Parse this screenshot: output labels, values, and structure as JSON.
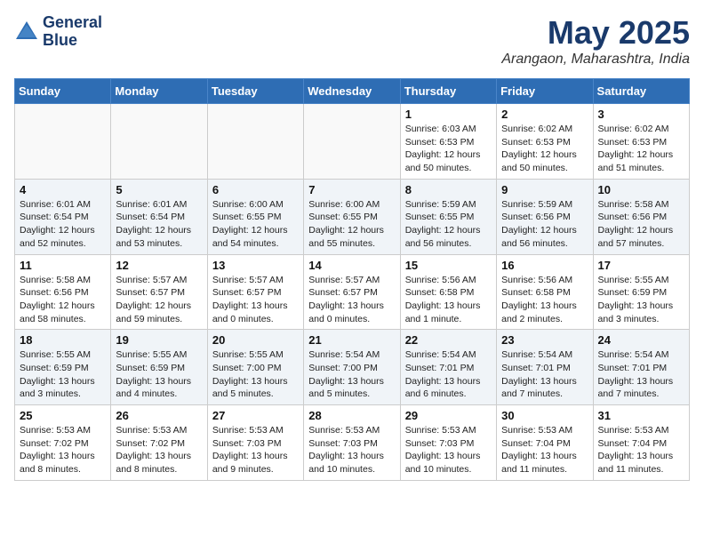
{
  "header": {
    "logo_line1": "General",
    "logo_line2": "Blue",
    "month": "May 2025",
    "location": "Arangaon, Maharashtra, India"
  },
  "weekdays": [
    "Sunday",
    "Monday",
    "Tuesday",
    "Wednesday",
    "Thursday",
    "Friday",
    "Saturday"
  ],
  "weeks": [
    [
      {
        "day": "",
        "info": ""
      },
      {
        "day": "",
        "info": ""
      },
      {
        "day": "",
        "info": ""
      },
      {
        "day": "",
        "info": ""
      },
      {
        "day": "1",
        "info": "Sunrise: 6:03 AM\nSunset: 6:53 PM\nDaylight: 12 hours and 50 minutes."
      },
      {
        "day": "2",
        "info": "Sunrise: 6:02 AM\nSunset: 6:53 PM\nDaylight: 12 hours and 50 minutes."
      },
      {
        "day": "3",
        "info": "Sunrise: 6:02 AM\nSunset: 6:53 PM\nDaylight: 12 hours and 51 minutes."
      }
    ],
    [
      {
        "day": "4",
        "info": "Sunrise: 6:01 AM\nSunset: 6:54 PM\nDaylight: 12 hours and 52 minutes."
      },
      {
        "day": "5",
        "info": "Sunrise: 6:01 AM\nSunset: 6:54 PM\nDaylight: 12 hours and 53 minutes."
      },
      {
        "day": "6",
        "info": "Sunrise: 6:00 AM\nSunset: 6:55 PM\nDaylight: 12 hours and 54 minutes."
      },
      {
        "day": "7",
        "info": "Sunrise: 6:00 AM\nSunset: 6:55 PM\nDaylight: 12 hours and 55 minutes."
      },
      {
        "day": "8",
        "info": "Sunrise: 5:59 AM\nSunset: 6:55 PM\nDaylight: 12 hours and 56 minutes."
      },
      {
        "day": "9",
        "info": "Sunrise: 5:59 AM\nSunset: 6:56 PM\nDaylight: 12 hours and 56 minutes."
      },
      {
        "day": "10",
        "info": "Sunrise: 5:58 AM\nSunset: 6:56 PM\nDaylight: 12 hours and 57 minutes."
      }
    ],
    [
      {
        "day": "11",
        "info": "Sunrise: 5:58 AM\nSunset: 6:56 PM\nDaylight: 12 hours and 58 minutes."
      },
      {
        "day": "12",
        "info": "Sunrise: 5:57 AM\nSunset: 6:57 PM\nDaylight: 12 hours and 59 minutes."
      },
      {
        "day": "13",
        "info": "Sunrise: 5:57 AM\nSunset: 6:57 PM\nDaylight: 13 hours and 0 minutes."
      },
      {
        "day": "14",
        "info": "Sunrise: 5:57 AM\nSunset: 6:57 PM\nDaylight: 13 hours and 0 minutes."
      },
      {
        "day": "15",
        "info": "Sunrise: 5:56 AM\nSunset: 6:58 PM\nDaylight: 13 hours and 1 minute."
      },
      {
        "day": "16",
        "info": "Sunrise: 5:56 AM\nSunset: 6:58 PM\nDaylight: 13 hours and 2 minutes."
      },
      {
        "day": "17",
        "info": "Sunrise: 5:55 AM\nSunset: 6:59 PM\nDaylight: 13 hours and 3 minutes."
      }
    ],
    [
      {
        "day": "18",
        "info": "Sunrise: 5:55 AM\nSunset: 6:59 PM\nDaylight: 13 hours and 3 minutes."
      },
      {
        "day": "19",
        "info": "Sunrise: 5:55 AM\nSunset: 6:59 PM\nDaylight: 13 hours and 4 minutes."
      },
      {
        "day": "20",
        "info": "Sunrise: 5:55 AM\nSunset: 7:00 PM\nDaylight: 13 hours and 5 minutes."
      },
      {
        "day": "21",
        "info": "Sunrise: 5:54 AM\nSunset: 7:00 PM\nDaylight: 13 hours and 5 minutes."
      },
      {
        "day": "22",
        "info": "Sunrise: 5:54 AM\nSunset: 7:01 PM\nDaylight: 13 hours and 6 minutes."
      },
      {
        "day": "23",
        "info": "Sunrise: 5:54 AM\nSunset: 7:01 PM\nDaylight: 13 hours and 7 minutes."
      },
      {
        "day": "24",
        "info": "Sunrise: 5:54 AM\nSunset: 7:01 PM\nDaylight: 13 hours and 7 minutes."
      }
    ],
    [
      {
        "day": "25",
        "info": "Sunrise: 5:53 AM\nSunset: 7:02 PM\nDaylight: 13 hours and 8 minutes."
      },
      {
        "day": "26",
        "info": "Sunrise: 5:53 AM\nSunset: 7:02 PM\nDaylight: 13 hours and 8 minutes."
      },
      {
        "day": "27",
        "info": "Sunrise: 5:53 AM\nSunset: 7:03 PM\nDaylight: 13 hours and 9 minutes."
      },
      {
        "day": "28",
        "info": "Sunrise: 5:53 AM\nSunset: 7:03 PM\nDaylight: 13 hours and 10 minutes."
      },
      {
        "day": "29",
        "info": "Sunrise: 5:53 AM\nSunset: 7:03 PM\nDaylight: 13 hours and 10 minutes."
      },
      {
        "day": "30",
        "info": "Sunrise: 5:53 AM\nSunset: 7:04 PM\nDaylight: 13 hours and 11 minutes."
      },
      {
        "day": "31",
        "info": "Sunrise: 5:53 AM\nSunset: 7:04 PM\nDaylight: 13 hours and 11 minutes."
      }
    ]
  ]
}
